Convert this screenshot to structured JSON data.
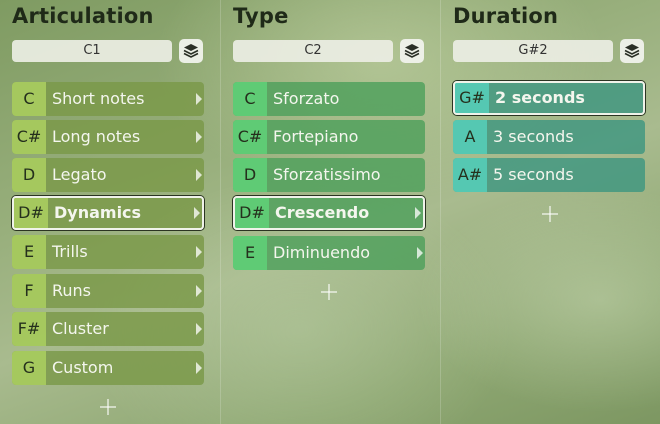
{
  "columns": [
    {
      "title": "Articulation",
      "trigger": "C1",
      "items": [
        {
          "key": "C",
          "label": "Short notes",
          "selected": false
        },
        {
          "key": "C#",
          "label": "Long notes",
          "selected": false
        },
        {
          "key": "D",
          "label": "Legato",
          "selected": false
        },
        {
          "key": "D#",
          "label": "Dynamics",
          "selected": true
        },
        {
          "key": "E",
          "label": "Trills",
          "selected": false
        },
        {
          "key": "F",
          "label": "Runs",
          "selected": false
        },
        {
          "key": "F#",
          "label": "Cluster",
          "selected": false
        },
        {
          "key": "G",
          "label": "Custom",
          "selected": false
        }
      ]
    },
    {
      "title": "Type",
      "trigger": "C2",
      "items": [
        {
          "key": "C",
          "label": "Sforzato",
          "selected": false
        },
        {
          "key": "C#",
          "label": "Fortepiano",
          "selected": false
        },
        {
          "key": "D",
          "label": "Sforzatissimo",
          "selected": false
        },
        {
          "key": "D#",
          "label": "Crescendo",
          "selected": true
        },
        {
          "key": "E",
          "label": "Diminuendo",
          "selected": false
        }
      ]
    },
    {
      "title": "Duration",
      "trigger": "G#2",
      "items": [
        {
          "key": "G#",
          "label": "2 seconds",
          "selected": true
        },
        {
          "key": "A",
          "label": "3 seconds",
          "selected": false
        },
        {
          "key": "A#",
          "label": "5 seconds",
          "selected": false
        }
      ]
    }
  ],
  "icons": {
    "layers": "layers-icon",
    "add": "plus-icon",
    "chevron": "chevron-right-icon"
  }
}
